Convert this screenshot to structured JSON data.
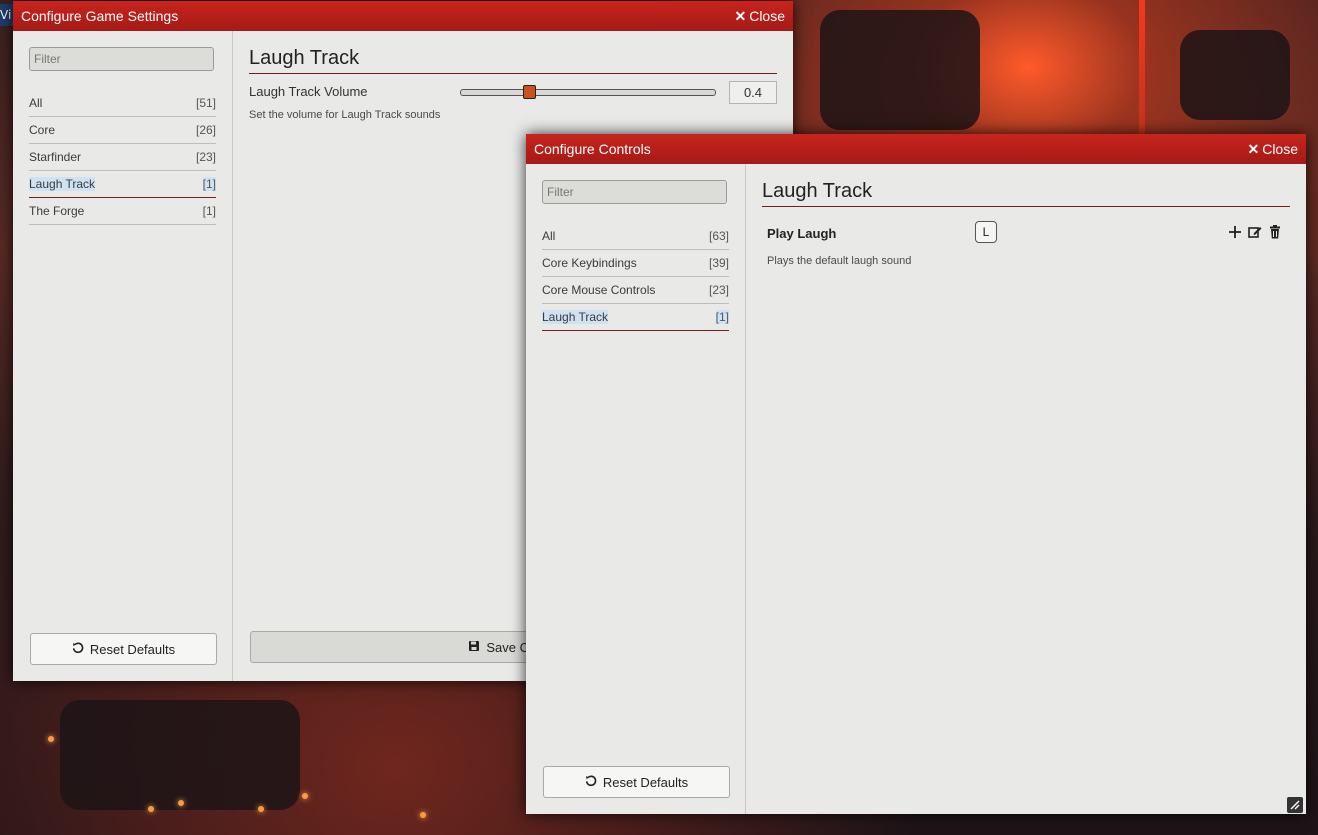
{
  "background": {
    "corner_tag": "Vi"
  },
  "settings_window": {
    "title": "Configure Game Settings",
    "close_label": "Close",
    "filter_placeholder": "Filter",
    "categories": [
      {
        "label": "All",
        "count": "[51]"
      },
      {
        "label": "Core",
        "count": "[26]"
      },
      {
        "label": "Starfinder",
        "count": "[23]"
      },
      {
        "label": "Laugh Track",
        "count": "[1]",
        "active": true
      },
      {
        "label": "The Forge",
        "count": "[1]"
      }
    ],
    "reset_label": "Reset Defaults",
    "section_title": "Laugh Track",
    "setting": {
      "name": "Laugh Track Volume",
      "hint": "Set the volume for Laugh Track sounds",
      "value": "0.4",
      "slider_fraction": 0.27
    },
    "save_label": "Save Changes"
  },
  "controls_window": {
    "title": "Configure Controls",
    "close_label": "Close",
    "filter_placeholder": "Filter",
    "categories": [
      {
        "label": "All",
        "count": "[63]"
      },
      {
        "label": "Core Keybindings",
        "count": "[39]"
      },
      {
        "label": "Core Mouse Controls",
        "count": "[23]"
      },
      {
        "label": "Laugh Track",
        "count": "[1]",
        "active": true
      }
    ],
    "reset_label": "Reset Defaults",
    "section_title": "Laugh Track",
    "binding": {
      "name": "Play Laugh",
      "key": "L",
      "hint": "Plays the default laugh sound"
    }
  },
  "colors": {
    "header_red": "#b81f1a",
    "active_highlight": "#cfe2f3",
    "slider_thumb": "#c9531f"
  }
}
